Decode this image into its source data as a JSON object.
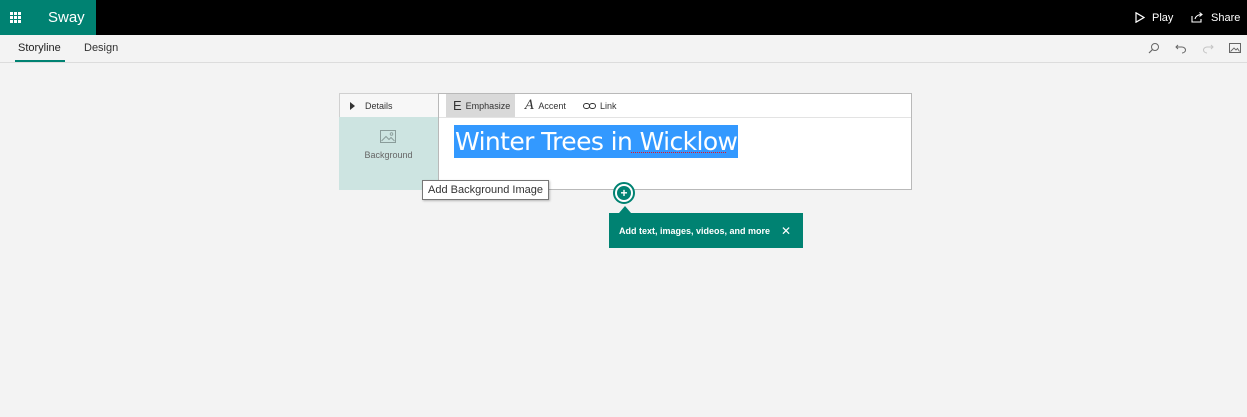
{
  "app": {
    "name": "Sway",
    "brand_color": "#008272"
  },
  "topbar": {
    "play_label": "Play",
    "share_label": "Share",
    "icons": [
      "waffle-icon",
      "play-icon",
      "share-icon"
    ]
  },
  "tabs": [
    {
      "label": "Storyline",
      "active": true
    },
    {
      "label": "Design",
      "active": false
    }
  ],
  "tools": [
    "search-icon",
    "undo-icon",
    "redo-icon",
    "image-icon"
  ],
  "card": {
    "details_label": "Details",
    "background_label": "Background",
    "toolbar": {
      "emphasize_label": "Emphasize",
      "accent_label": "Accent",
      "link_label": "Link"
    },
    "title": "Winter Trees in Wicklow",
    "selection_color": "#3399ff",
    "background_panel_color": "#cde4e1"
  },
  "tooltip": {
    "text": "Add Background Image"
  },
  "add_content": {
    "button_glyph": "+",
    "teaching_text": "Add text, images, videos, and more",
    "close_glyph": "✕"
  }
}
